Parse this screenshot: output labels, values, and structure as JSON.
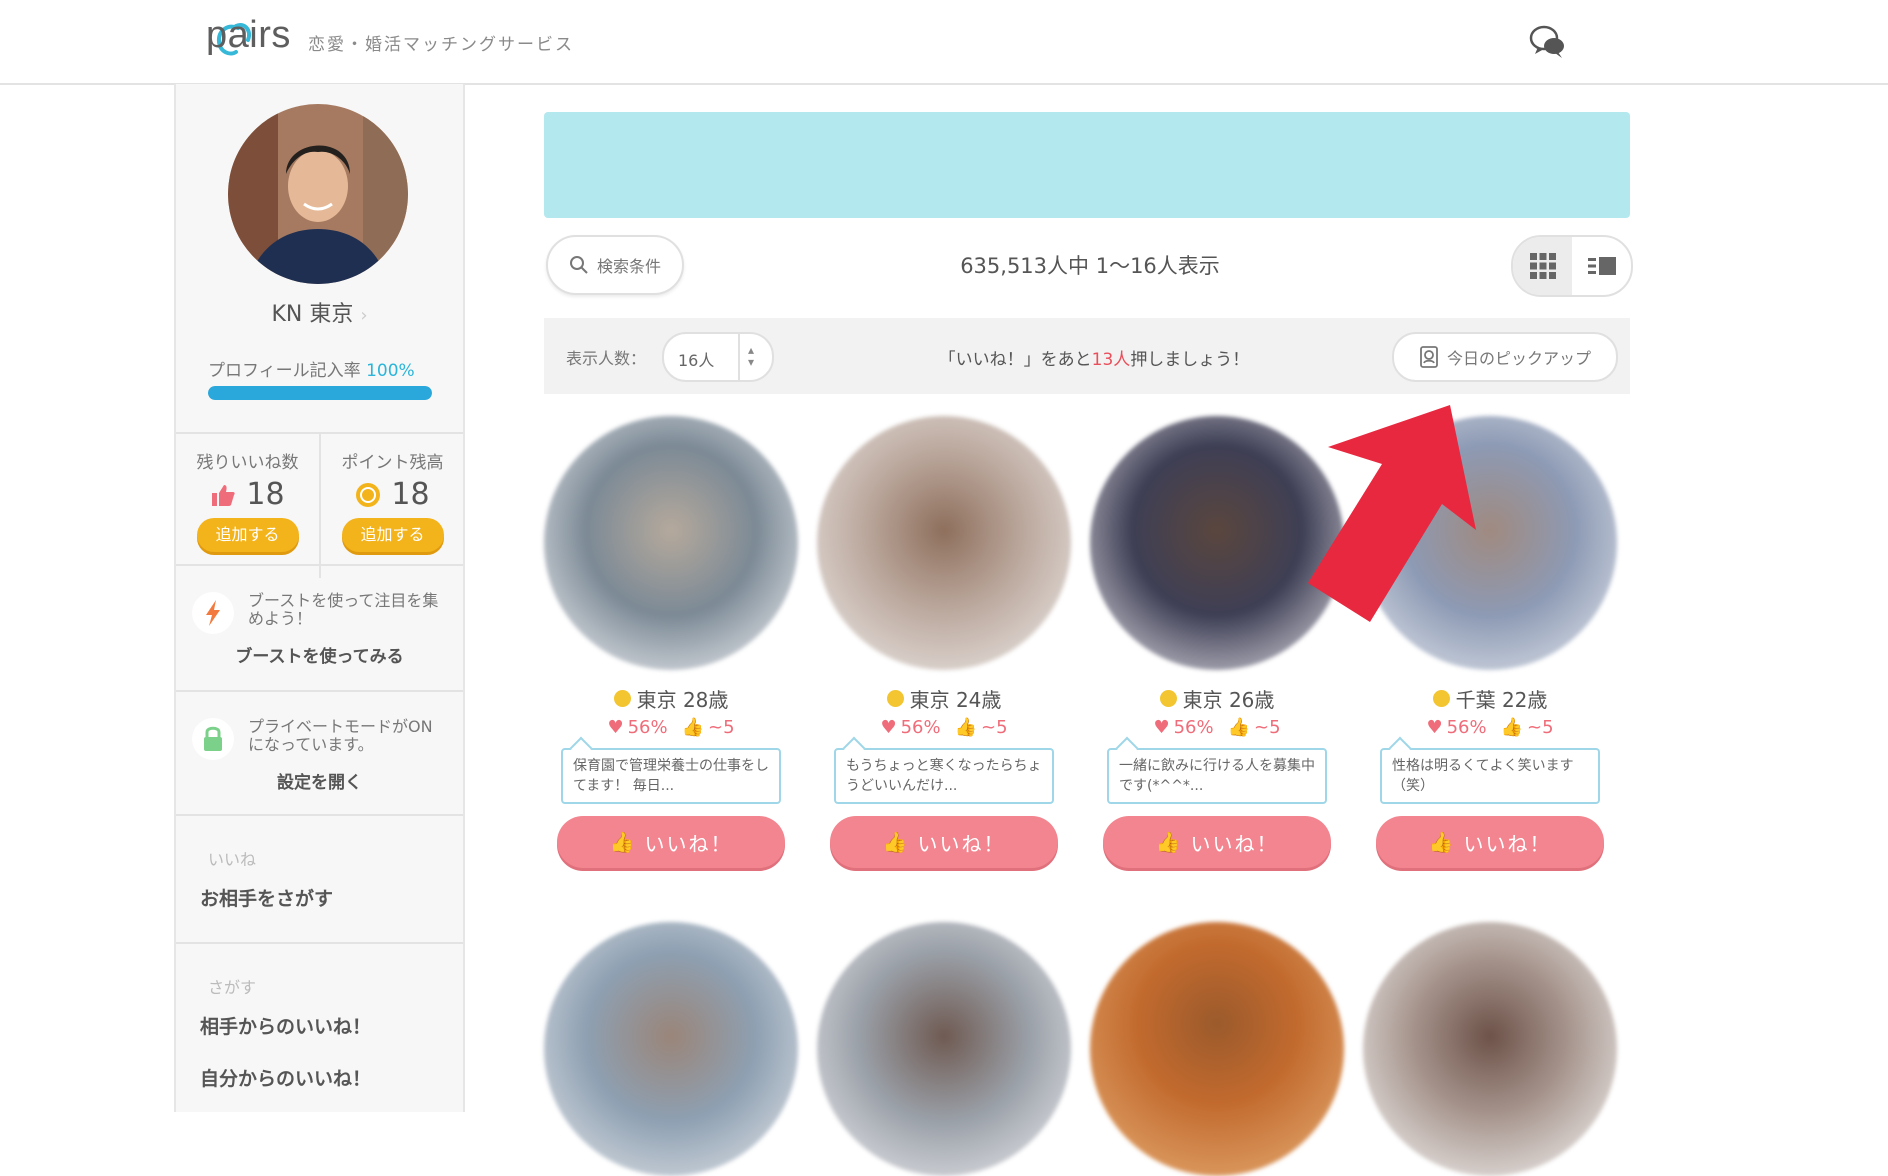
{
  "header": {
    "logo_text": "pairs",
    "tagline": "恋愛・婚活マッチングサービス",
    "chat_icon": "chat-bubbles-icon"
  },
  "sidebar": {
    "profile_name": "KN 東京",
    "profile_chevron": "›",
    "profile_rate_label": "プロフィール記入率",
    "profile_rate_value": "100%",
    "profile_rate_fraction": 1.0,
    "likes_label": "残りいいね数",
    "likes_value": "18",
    "likes_add": "追加する",
    "points_label": "ポイント残高",
    "points_value": "18",
    "points_add": "追加する",
    "boost_text": "ブーストを使って注目を集めよう！",
    "boost_link": "ブーストを使ってみる",
    "private_text": "プライベートモードがONになっています。",
    "private_link": "設定を開く",
    "section_likes": "いいね",
    "nav_find": "お相手をさがす",
    "section_search": "さがす",
    "nav_received": "相手からのいいね！",
    "nav_sent": "自分からのいいね！"
  },
  "main": {
    "search_button": "検索条件",
    "result_count": "635,513人中 1〜16人表示",
    "display_label": "表示人数：",
    "display_value": "16人",
    "like_message_pre": "「いいね！」をあと",
    "like_message_num": "13人",
    "like_message_post": "押しましょう！",
    "pickup_button": "今日のピックアップ"
  },
  "cards": [
    {
      "location": "東京 28歳",
      "match": "56%",
      "likes": "~5",
      "message": "保育園で管理栄養士の仕事をしてます！ 毎日...",
      "like_label": "いいね！",
      "color": "#8a9aa8"
    },
    {
      "location": "東京 24歳",
      "match": "56%",
      "likes": "~5",
      "message": "もうちょっと寒くなったらちょうどいいんだけ...",
      "like_label": "いいね！",
      "color": "#b9a89c"
    },
    {
      "location": "東京 26歳",
      "match": "56%",
      "likes": "~5",
      "message": "一緒に飲みに行ける人を募集中です(*^^*...",
      "like_label": "いいね！",
      "color": "#6f6a78"
    },
    {
      "location": "千葉 22歳",
      "match": "56%",
      "likes": "~5",
      "message": "性格は明るくてよく笑います（笑）",
      "like_label": "いいね！",
      "color": "#8795ad"
    }
  ],
  "colors": {
    "accent": "#2aa8dc",
    "like": "#f2858f",
    "gold": "#f3b31b",
    "banner": "#b3e8ef",
    "arrow": "#e8283f"
  }
}
